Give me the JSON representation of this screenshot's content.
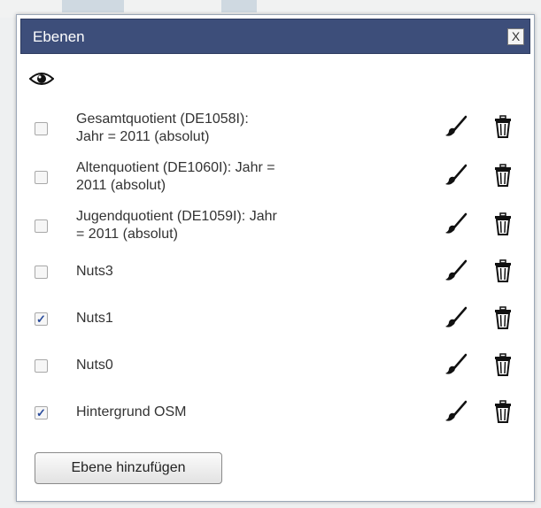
{
  "dialog": {
    "title": "Ebenen",
    "close_label": "X"
  },
  "layers": [
    {
      "label_lines": [
        "Gesamtquotient (DE1058I):",
        "Jahr = 2011 (absolut)"
      ],
      "checked": false
    },
    {
      "label_lines": [
        "Altenquotient (DE1060I): Jahr =",
        "2011 (absolut)"
      ],
      "checked": false
    },
    {
      "label_lines": [
        "Jugendquotient (DE1059I): Jahr",
        "= 2011 (absolut)"
      ],
      "checked": false
    },
    {
      "label_lines": [
        "Nuts3"
      ],
      "checked": false
    },
    {
      "label_lines": [
        "Nuts1"
      ],
      "checked": true
    },
    {
      "label_lines": [
        "Nuts0"
      ],
      "checked": false
    },
    {
      "label_lines": [
        "Hintergrund OSM"
      ],
      "checked": true
    }
  ],
  "icons": {
    "visibility": "eye-icon",
    "style": "paintbrush-icon",
    "delete": "trash-icon"
  },
  "check_mark": "✓",
  "footer": {
    "add_label": "Ebene hinzufügen"
  },
  "colors": {
    "titlebar": "#3d4e7a",
    "checkmark": "#2a4c9c"
  }
}
